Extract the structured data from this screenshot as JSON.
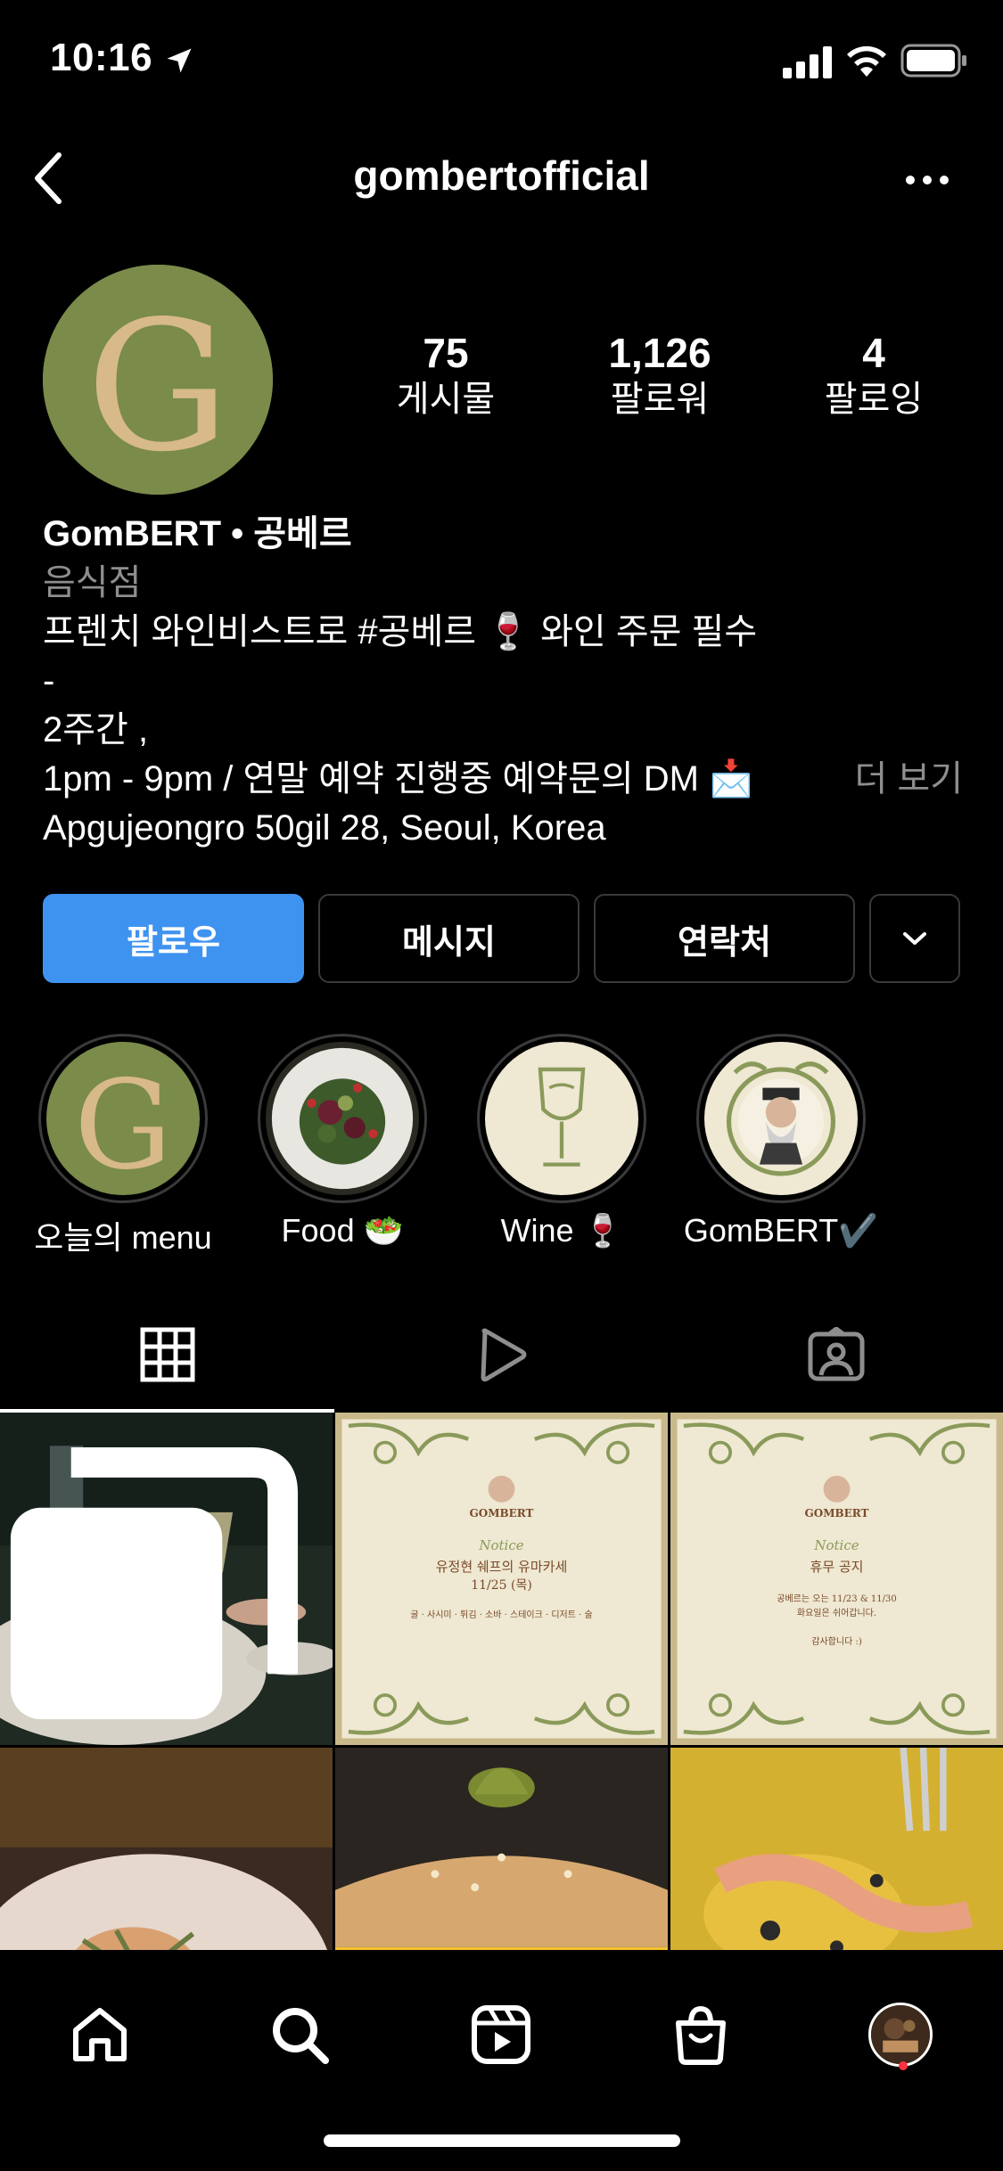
{
  "status_bar": {
    "time": "10:16"
  },
  "header": {
    "username": "gombertofficial"
  },
  "profile": {
    "stats": [
      {
        "num": "75",
        "label": "게시물"
      },
      {
        "num": "1,126",
        "label": "팔로워"
      },
      {
        "num": "4",
        "label": "팔로잉"
      }
    ],
    "name": "GomBERT • 공베르",
    "category": "음식점",
    "bio_lines": [
      "프렌치 와인비스트로 #공베르 🍷 와인 주문 필수",
      "-",
      "2주간 ,",
      "1pm - 9pm / 연말 예약 진행중 예약문의 DM 📩",
      "Apgujeongro 50gil 28, Seoul, Korea"
    ],
    "more_label": "더 보기"
  },
  "buttons": {
    "follow": "팔로우",
    "message": "메시지",
    "contact": "연락처"
  },
  "highlights": [
    {
      "label": "오늘의 menu"
    },
    {
      "label": "Food 🥗"
    },
    {
      "label": "Wine 🍷"
    },
    {
      "label": "GomBERT✔️"
    }
  ],
  "posts": {
    "notice1": {
      "brand": "GOMBERT",
      "script": "Notice",
      "title": "유정현 쉐프의 유마카세",
      "date": "11/25 (목)",
      "menu": "굴 · 사시미 · 튀김 · 소바 · 스테이크 · 디저트 · 술"
    },
    "notice2": {
      "brand": "GOMBERT",
      "script": "Notice",
      "title": "휴무 공지",
      "body1": "공베르는 오는 11/23 & 11/30",
      "body2": "화요일은 쉬어갑니다.",
      "thanks": "감사합니다 :)"
    }
  },
  "colors": {
    "follow_button": "#3f93f0",
    "avatar_bg": "#7a8b4a",
    "avatar_letter": "#d8b98a",
    "notice_bg": "#efe8d2",
    "notification_dot": "#ff3040"
  }
}
